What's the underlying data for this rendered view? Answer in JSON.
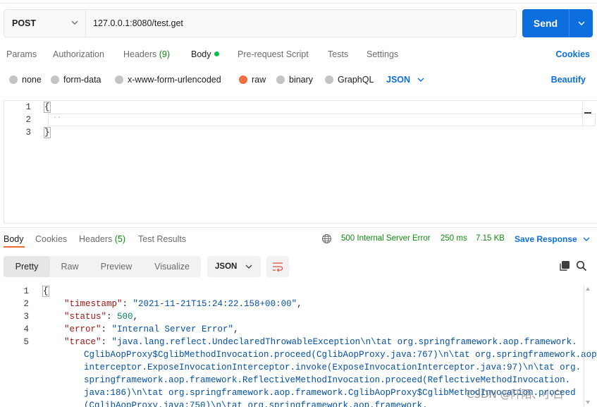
{
  "request": {
    "method": "POST",
    "url": "127.0.0.1:8080/test.get",
    "send_label": "Send"
  },
  "request_tabs": {
    "params": "Params",
    "authorization": "Authorization",
    "headers": "Headers",
    "headers_count": "(9)",
    "body": "Body",
    "prerequest": "Pre-request Script",
    "tests": "Tests",
    "settings": "Settings",
    "cookies": "Cookies"
  },
  "body_types": {
    "options": [
      "none",
      "form-data",
      "x-www-form-urlencoded",
      "raw",
      "binary",
      "GraphQL"
    ],
    "selected": "raw",
    "format": "JSON",
    "beautify": "Beautify"
  },
  "request_editor": {
    "line_numbers": [
      "1",
      "2",
      "3"
    ],
    "lines": [
      "{",
      "  ··",
      "}"
    ]
  },
  "response_tabs": {
    "body": "Body",
    "cookies": "Cookies",
    "headers": "Headers",
    "headers_count": "(5)",
    "test_results": "Test Results"
  },
  "response_status": {
    "status": "500 Internal Server Error",
    "time": "250 ms",
    "size": "7.15 KB",
    "save_response": "Save Response"
  },
  "view_modes": {
    "pretty": "Pretty",
    "raw": "Raw",
    "preview": "Preview",
    "visualize": "Visualize",
    "format": "JSON"
  },
  "response_body": {
    "line_numbers": [
      "1",
      "2",
      "3",
      "4",
      "5"
    ],
    "open_brace": "{",
    "timestamp_key": "\"timestamp\"",
    "timestamp_val": "\"2021-11-21T15:24:22.158+00:00\"",
    "status_key": "\"status\"",
    "status_val": "500",
    "error_key": "\"error\"",
    "error_val": "\"Internal Server Error\"",
    "trace_key": "\"trace\"",
    "trace_lines": [
      "\"java.lang.reflect.UndeclaredThrowableException\\n\\tat org.springframework.aop.framework.",
      "CglibAopProxy$CglibMethodInvocation.proceed(CglibAopProxy.java:767)\\n\\tat org.springframework.aop.",
      "interceptor.ExposeInvocationInterceptor.invoke(ExposeInvocationInterceptor.java:97)\\n\\tat org.",
      "springframework.aop.framework.ReflectiveMethodInvocation.proceed(ReflectiveMethodInvocation.",
      "java:186)\\n\\tat org.springframework.aop.framework.CglibAopProxy$CglibMethodInvocation.proceed",
      "(CglibAopProxy.java:750)\\n\\tat org.springframework.aop.framework."
    ]
  },
  "watermark": "CSDN @阡陌、小白"
}
